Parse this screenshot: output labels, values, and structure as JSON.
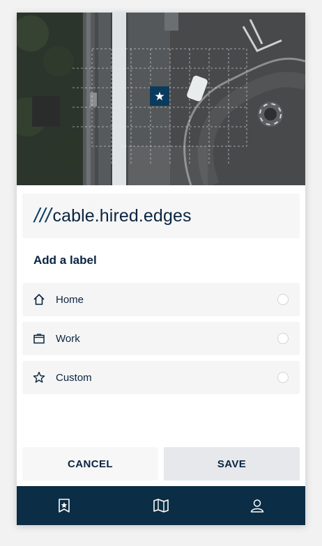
{
  "map": {
    "marker_icon": "star-icon",
    "marker_glyph": "★"
  },
  "address": {
    "prefix": "///",
    "words": "cable.hired.edges"
  },
  "labels": {
    "title": "Add a label",
    "options": [
      {
        "icon": "home-icon",
        "label": "Home",
        "selected": false
      },
      {
        "icon": "briefcase-icon",
        "label": "Work",
        "selected": false
      },
      {
        "icon": "star-outline-icon",
        "label": "Custom",
        "selected": false
      }
    ]
  },
  "actions": {
    "cancel_label": "CANCEL",
    "save_label": "SAVE"
  },
  "navbar": {
    "items": [
      {
        "icon": "saved-star-icon"
      },
      {
        "icon": "map-icon"
      },
      {
        "icon": "profile-icon"
      }
    ]
  },
  "colors": {
    "brand_navy": "#0b2d45",
    "marker": "#0b3b5c",
    "text": "#0a2540"
  }
}
